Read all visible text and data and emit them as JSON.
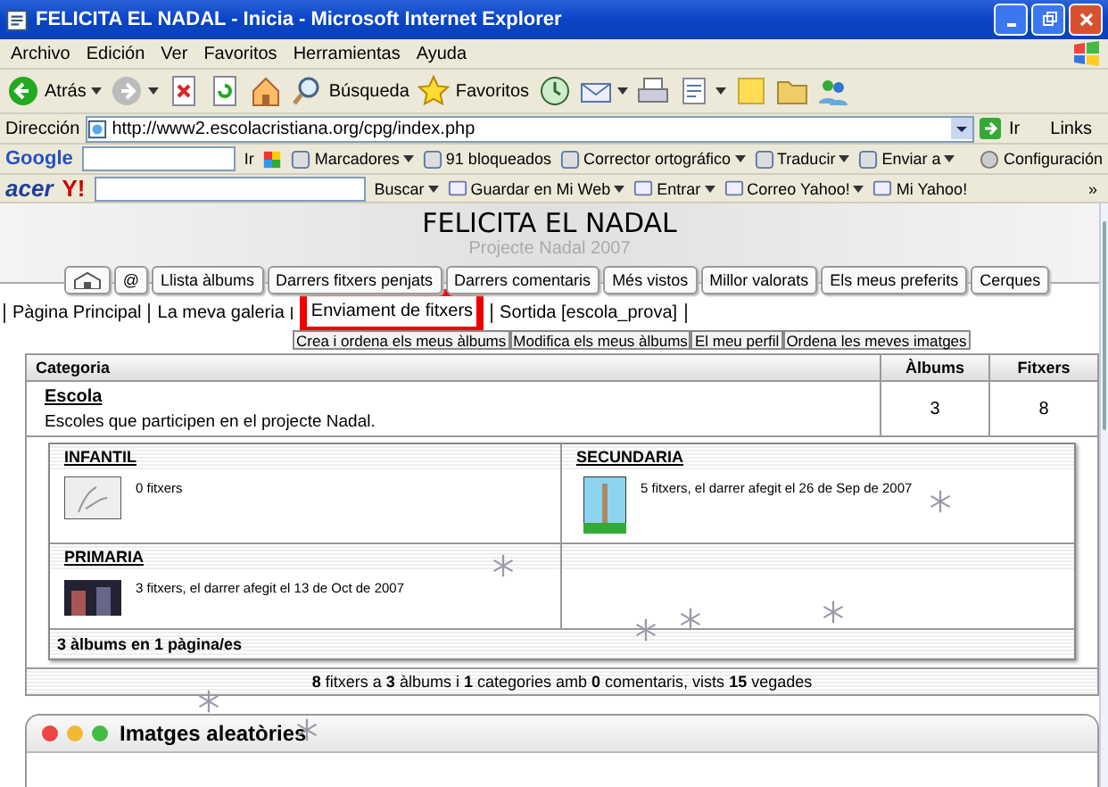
{
  "window": {
    "title": "FELICITA EL NADAL - Inicia - Microsoft Internet Explorer"
  },
  "menu": [
    "Archivo",
    "Edición",
    "Ver",
    "Favoritos",
    "Herramientas",
    "Ayuda"
  ],
  "toolbar": [
    {
      "label": "Atrás",
      "dropdown": true
    },
    {
      "dropdown": true
    },
    {
      "dropdown": false
    },
    {
      "dropdown": false
    },
    {
      "dropdown": false
    },
    {
      "label": "Búsqueda",
      "dropdown": false
    },
    {
      "label": "Favoritos",
      "dropdown": false
    },
    {
      "dropdown": false
    },
    {
      "dropdown": true
    },
    {
      "dropdown": false
    },
    {
      "dropdown": true
    },
    {
      "dropdown": false
    },
    {
      "dropdown": false
    },
    {
      "dropdown": false
    }
  ],
  "address": {
    "label": "Dirección",
    "url": "http://www2.escolacristiana.org/cpg/index.php",
    "go": "Ir",
    "links": "Links"
  },
  "google_bar": {
    "logo": "Google",
    "go": "Ir",
    "items": [
      {
        "label": "Marcadores",
        "dropdown": true
      },
      {
        "label": "91 bloqueados",
        "dropdown": false
      },
      {
        "label": "Corrector ortográfico",
        "dropdown": true
      },
      {
        "label": "Traducir",
        "dropdown": true
      },
      {
        "label": "Enviar a",
        "dropdown": true
      }
    ],
    "settings": "Configuración"
  },
  "yahoo_bar": {
    "logo": "acer",
    "yahoo": "Y!",
    "search": "Buscar",
    "items": [
      {
        "label": "Guardar en Mi Web",
        "dropdown": true
      },
      {
        "label": "Entrar",
        "dropdown": true
      },
      {
        "label": "Correo Yahoo!",
        "dropdown": true
      },
      {
        "label": "Mi Yahoo!",
        "dropdown": false
      }
    ],
    "more": "»"
  },
  "site": {
    "title": "FELICITA EL NADAL",
    "subtitle": "Projecte Nadal 2007"
  },
  "tabs": [
    {
      "kind": "icon"
    },
    {
      "kind": "text",
      "label": "@"
    },
    {
      "kind": "text",
      "label": "Llista àlbums"
    },
    {
      "kind": "text",
      "label": "Darrers fitxers penjats"
    },
    {
      "kind": "text",
      "label": "Darrers comentaris"
    },
    {
      "kind": "text",
      "label": "Més vistos"
    },
    {
      "kind": "text",
      "label": "Millor valorats"
    },
    {
      "kind": "text",
      "label": "Els meus preferits"
    },
    {
      "kind": "text",
      "label": "Cerques"
    }
  ],
  "sub_links": [
    {
      "label": "Pàgina Principal",
      "annotated": false
    },
    {
      "label": "La meva galeria",
      "annotated": false
    },
    {
      "label": "Enviament de fitxers",
      "annotated": true
    },
    {
      "label": "Sortida [escola_prova]",
      "annotated": false
    }
  ],
  "album_actions": [
    "Crea i ordena els meus àlbums",
    "Modifica els meus àlbums",
    "El meu perfil",
    "Ordena les meves imatges"
  ],
  "table": {
    "columns": [
      "Categoria",
      "Àlbums",
      "Fitxers"
    ],
    "rows": [
      {
        "name": "Escola",
        "description": "Escoles que participen en el projecte Nadal.",
        "albums": "3",
        "files": "8"
      }
    ]
  },
  "albums": [
    {
      "title": "INFANTIL",
      "info": "0 fitxers"
    },
    {
      "title": "SECUNDARIA",
      "info": "5 fitxers, el darrer afegit el 26 de Sep de 2007"
    },
    {
      "title": "PRIMARIA",
      "info": "3 fitxers, el darrer afegit el 13 de Oct de 2007"
    }
  ],
  "album_count": "3 àlbums en 1 pàgina/es",
  "stats": "**8** fitxers a **3** àlbums i **1** categories amb **0** comentaris, vists **15** vegades",
  "random_images": {
    "title": "Imatges aleatòries"
  }
}
